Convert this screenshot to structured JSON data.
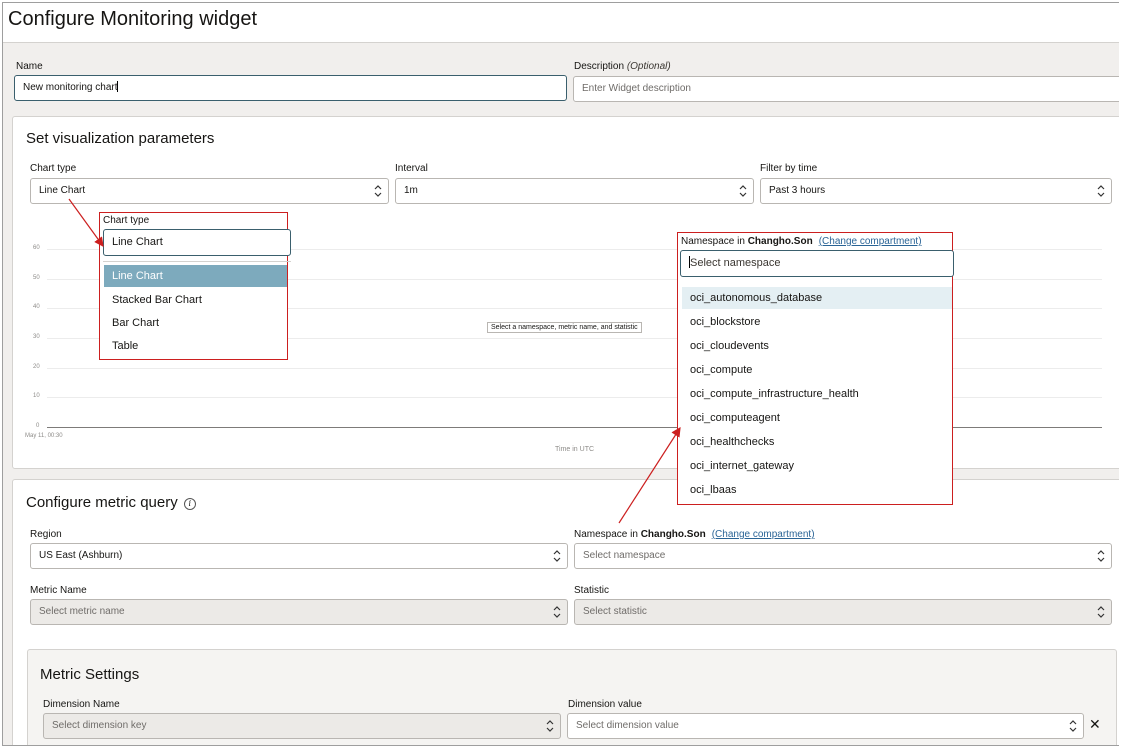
{
  "page": {
    "title": "Configure Monitoring widget"
  },
  "name_field": {
    "label": "Name",
    "value": "New monitoring chart"
  },
  "description_field": {
    "label": "Description",
    "optional": "(Optional)",
    "placeholder": "Enter Widget description"
  },
  "visualization": {
    "title": "Set visualization parameters",
    "chart_type": {
      "label": "Chart type",
      "value": "Line Chart"
    },
    "interval": {
      "label": "Interval",
      "value": "1m"
    },
    "filter_time": {
      "label": "Filter by time",
      "value": "Past 3 hours"
    }
  },
  "preview_chart": {
    "y_ticks": [
      "60",
      "50",
      "40",
      "30",
      "20",
      "10",
      "0"
    ],
    "x_tick": "May 11, 00:30",
    "x_title": "Time in UTC",
    "empty_message": "Select a namespace, metric name, and statistic"
  },
  "chart_type_popup": {
    "label": "Chart type",
    "value": "Line Chart",
    "options": [
      "Line Chart",
      "Stacked Bar Chart",
      "Bar Chart",
      "Table"
    ],
    "selected_index": 0
  },
  "namespace_popup": {
    "label_prefix": "Namespace in",
    "compartment": "Changho.Son",
    "change_link": "(Change compartment)",
    "placeholder": "Select namespace",
    "options": [
      "oci_autonomous_database",
      "oci_blockstore",
      "oci_cloudevents",
      "oci_compute",
      "oci_compute_infrastructure_health",
      "oci_computeagent",
      "oci_healthchecks",
      "oci_internet_gateway",
      "oci_lbaas"
    ],
    "highlighted_index": 0
  },
  "metric_query": {
    "title": "Configure metric query",
    "region": {
      "label": "Region",
      "value": "US East (Ashburn)"
    },
    "namespace": {
      "label_prefix": "Namespace in",
      "compartment": "Changho.Son",
      "change_link": "(Change compartment)",
      "placeholder": "Select namespace"
    },
    "metric_name": {
      "label": "Metric Name",
      "placeholder": "Select metric name"
    },
    "statistic": {
      "label": "Statistic",
      "placeholder": "Select statistic"
    }
  },
  "metric_settings": {
    "title": "Metric Settings",
    "dimension_name": {
      "label": "Dimension Name",
      "placeholder": "Select dimension key"
    },
    "dimension_value": {
      "label": "Dimension value",
      "placeholder": "Select dimension value"
    }
  },
  "colors": {
    "annotation_red": "#cc1f1f",
    "selected_option": "#7daabd",
    "focus_border": "#3a5f6d"
  },
  "icons": [
    "chevron-up-down-icon",
    "info-icon",
    "close-icon"
  ]
}
